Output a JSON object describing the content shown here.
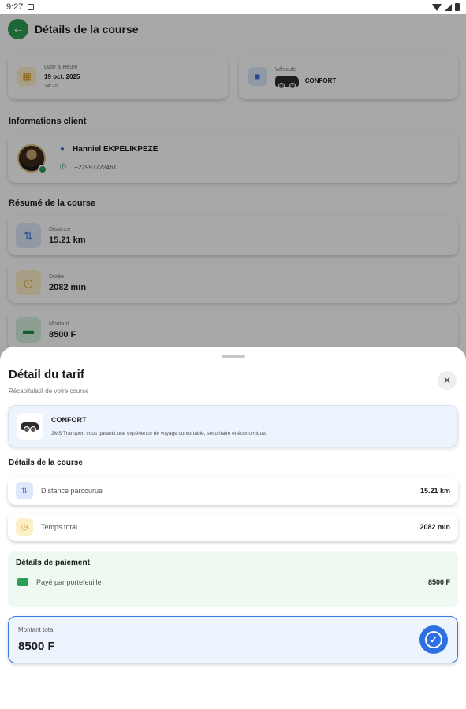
{
  "status_bar": {
    "time": "9:27"
  },
  "appbar": {
    "title": "Détails de la course"
  },
  "trip_info": {
    "date_label": "Date & Heure",
    "date_value": "19 oct. 2025",
    "time_value": "14:25",
    "vehicle_label": "Véhicule",
    "vehicle_value": "CONFORT"
  },
  "client": {
    "section_title": "Informations client",
    "name": "Hanniel EKPELIKPEZE",
    "phone": "+22997722461"
  },
  "summary": {
    "section_title": "Résumé de la course",
    "items": [
      {
        "label": "Distance",
        "value": "15.21 km",
        "icon": "route-icon"
      },
      {
        "label": "Durée",
        "value": "2082 min",
        "icon": "clock-icon"
      },
      {
        "label": "Montant",
        "value": "8500 F",
        "icon": "cash-icon"
      }
    ]
  },
  "sheet": {
    "title": "Détail du tarif",
    "subtitle": "Récapitulatif de votre course",
    "vehicle": {
      "name": "CONFORT",
      "description": "2MS Transport vous garantit une expérience de voyage confortable, sécuritaire et économique."
    },
    "details_title": "Détails de la course",
    "details": [
      {
        "label": "Distance parcourue",
        "value": "15.21 km"
      },
      {
        "label": "Temps total",
        "value": "2082 min"
      }
    ],
    "payment": {
      "title": "Détails de paiement",
      "label": "Payé par portefeuille",
      "value": "8500 F"
    },
    "total": {
      "label": "Montant total",
      "value": "8500 F"
    }
  },
  "colors": {
    "accent_green": "#2e9e56",
    "accent_blue": "#2f6fe4",
    "overlay": "rgba(0,0,0,0.34)"
  }
}
